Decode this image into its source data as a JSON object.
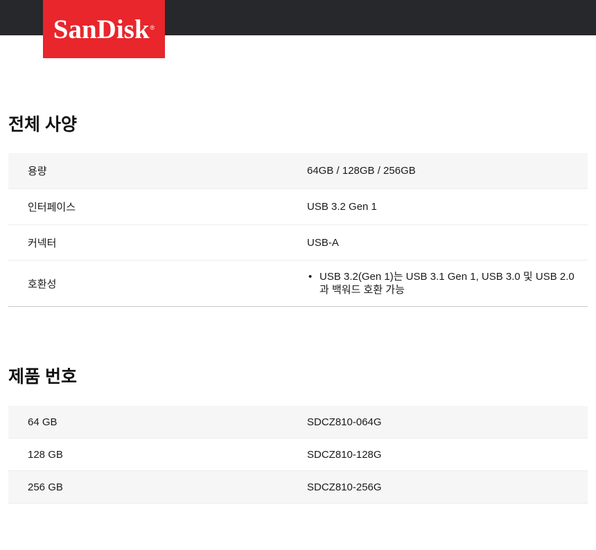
{
  "brand": {
    "logo_text": "SanDisk",
    "trademark": "®",
    "logo_color": "#e8262b",
    "topbar_color": "#27282c"
  },
  "specs": {
    "title": "전체 사양",
    "rows": [
      {
        "label": "용량",
        "value": "64GB / 128GB / 256GB"
      },
      {
        "label": "인터페이스",
        "value": "USB 3.2 Gen 1"
      },
      {
        "label": "커넥터",
        "value": "USB-A"
      },
      {
        "label": "호환성",
        "bullets": [
          "USB 3.2(Gen 1)는 USB 3.1 Gen 1, USB 3.0 및 USB 2.0과 백워드 호환 가능"
        ]
      }
    ]
  },
  "part_numbers": {
    "title": "제품 번호",
    "rows": [
      {
        "label": "64 GB",
        "value": "SDCZ810-064G"
      },
      {
        "label": "128 GB",
        "value": "SDCZ810-128G"
      },
      {
        "label": "256 GB",
        "value": "SDCZ810-256G"
      }
    ]
  }
}
